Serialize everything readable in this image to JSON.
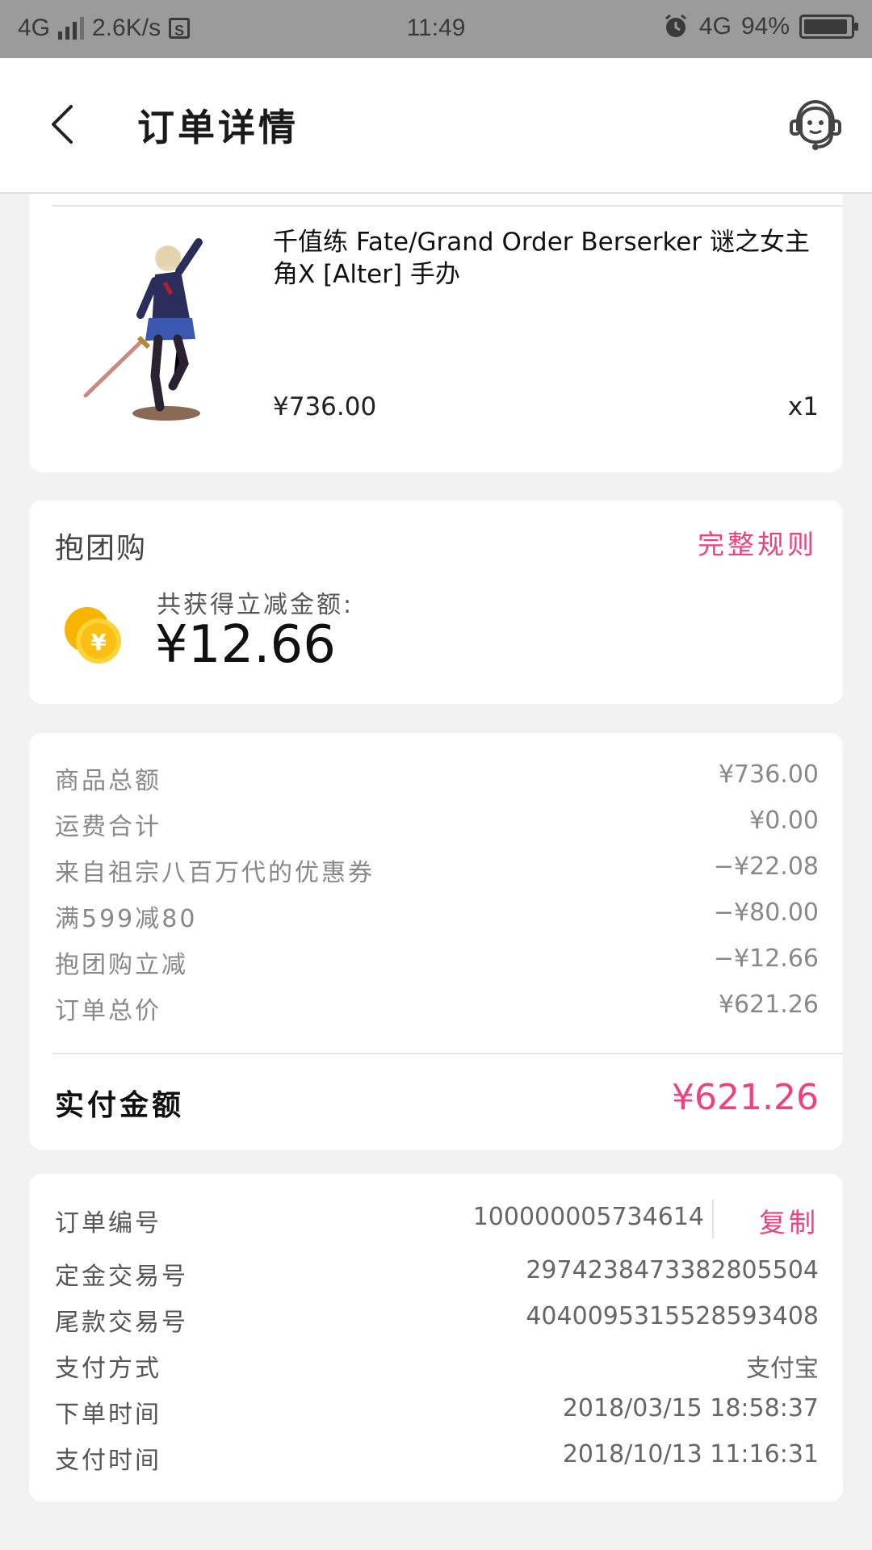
{
  "status_bar": {
    "network": "4G",
    "speed": "2.6K/s",
    "s_badge": "S",
    "time": "11:49",
    "net_right": "4G",
    "battery": "94%",
    "battery_level": 0.94
  },
  "header": {
    "title": "订单详情"
  },
  "product": {
    "name": "千值练 Fate/Grand Order Berserker 谜之女主角X [Alter] 手办",
    "price": "¥736.00",
    "quantity": "x1"
  },
  "group_buy": {
    "title": "抱团购",
    "rule_link": "完整规则",
    "label": "共获得立减金额:",
    "amount": "¥12.66",
    "coin_symbol": "¥"
  },
  "summary": {
    "rows": [
      {
        "label": "商品总额",
        "value": "¥736.00"
      },
      {
        "label": "运费合计",
        "value": "¥0.00"
      },
      {
        "label": "来自祖宗八百万代的优惠券",
        "value": "−¥22.08"
      },
      {
        "label": "满599减80",
        "value": "−¥80.00"
      },
      {
        "label": "抱团购立减",
        "value": "−¥12.66"
      },
      {
        "label": "订单总价",
        "value": "¥621.26"
      }
    ],
    "paid_label": "实付金额",
    "paid_value": "¥621.26"
  },
  "order_info": {
    "rows": [
      {
        "label": "订单编号",
        "value": "100000005734614"
      },
      {
        "label": "定金交易号",
        "value": "2974238473382805504"
      },
      {
        "label": "尾款交易号",
        "value": "4040095315528593408"
      },
      {
        "label": "支付方式",
        "value": "支付宝"
      },
      {
        "label": "下单时间",
        "value": "2018/03/15 18:58:37"
      },
      {
        "label": "支付时间",
        "value": "2018/10/13 11:16:31"
      }
    ],
    "copy_label": "复制"
  },
  "colors": {
    "accent": "#f0417e",
    "coin": "#f5b400",
    "status_bar": "#9b9b9b"
  }
}
